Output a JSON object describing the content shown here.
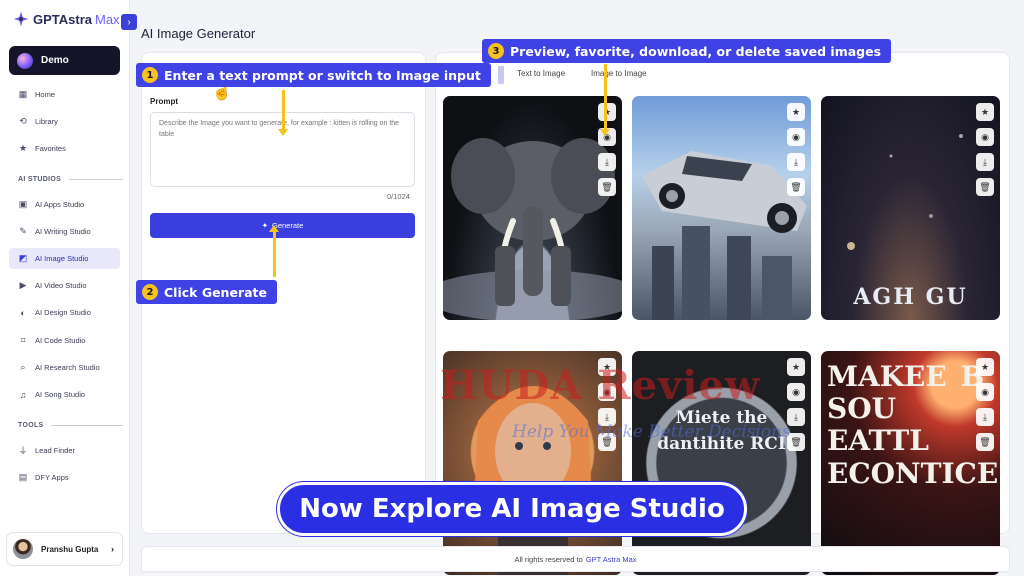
{
  "app": {
    "logo_main": "GPTAstra",
    "logo_max": "Max",
    "collapse_glyph": "›"
  },
  "sidebar": {
    "workspace": "Demo",
    "items": [
      {
        "label": "Home",
        "icon": "grid-icon",
        "glyph": "▦"
      },
      {
        "label": "Library",
        "icon": "history-icon",
        "glyph": "⟲"
      },
      {
        "label": "Favorites",
        "icon": "star-box-icon",
        "glyph": "★"
      }
    ],
    "section_studios": "AI STUDIOS",
    "studios": [
      {
        "label": "AI Apps Studio",
        "icon": "apps-icon",
        "glyph": "▣"
      },
      {
        "label": "AI Writing Studio",
        "icon": "pen-icon",
        "glyph": "✎"
      },
      {
        "label": "AI Image Studio",
        "icon": "image-icon",
        "glyph": "◩",
        "active": true
      },
      {
        "label": "AI Video Studio",
        "icon": "video-icon",
        "glyph": "▶"
      },
      {
        "label": "AI Design Studio",
        "icon": "design-icon",
        "glyph": "◐"
      },
      {
        "label": "AI Code Studio",
        "icon": "code-icon",
        "glyph": "⌗"
      },
      {
        "label": "AI Research Studio",
        "icon": "research-icon",
        "glyph": "⌕"
      },
      {
        "label": "AI Song Studio",
        "icon": "music-icon",
        "glyph": "♫"
      }
    ],
    "section_tools": "TOOLS",
    "tools": [
      {
        "label": "Lead Finder",
        "icon": "funnel-icon",
        "glyph": "⏚"
      },
      {
        "label": "DFY Apps",
        "icon": "apps-icon",
        "glyph": "▤"
      }
    ],
    "user_name": "Pranshu Gupta",
    "user_chevron": "›"
  },
  "main": {
    "title": "AI Image Generator",
    "prompt_label": "Prompt",
    "prompt_placeholder": "Describe the Image you want to generate, for example : kitten is rolling on the table",
    "char_count": "0/1024",
    "generate_label": "Generate",
    "generate_glyph": "✦",
    "tabs": [
      "Text to Image",
      "Image to Image"
    ]
  },
  "gallery": {
    "action_glyphs": [
      "★",
      "◉",
      "⤓",
      "🗑"
    ],
    "action_icons": [
      "star-icon",
      "eye-icon",
      "download-icon",
      "trash-icon"
    ],
    "tile_texts": [
      "",
      "",
      "AGH GU",
      "",
      "Miete the dantihite RCI",
      "MAKEE B SOU EATTL ECONTICE"
    ]
  },
  "callouts": {
    "c1_num": "1",
    "c1_text": "Enter a text prompt or switch to Image input",
    "c2_num": "2",
    "c2_text": "Click Generate",
    "c3_num": "3",
    "c3_text": "Preview, favorite, download, or delete saved images"
  },
  "banner": "Now Explore AI Image Studio",
  "watermark": {
    "main": "HUDA Review",
    "sub": "Help You Make Better Decisions"
  },
  "footer": {
    "prefix": "All rights reserved to",
    "brand": "GPT Astra Max"
  },
  "colors": {
    "accent": "#3b3fe0",
    "callout_bg": "#3f43e6",
    "callout_number": "#f6c21b",
    "active_nav_bg": "#e9e8fb"
  }
}
